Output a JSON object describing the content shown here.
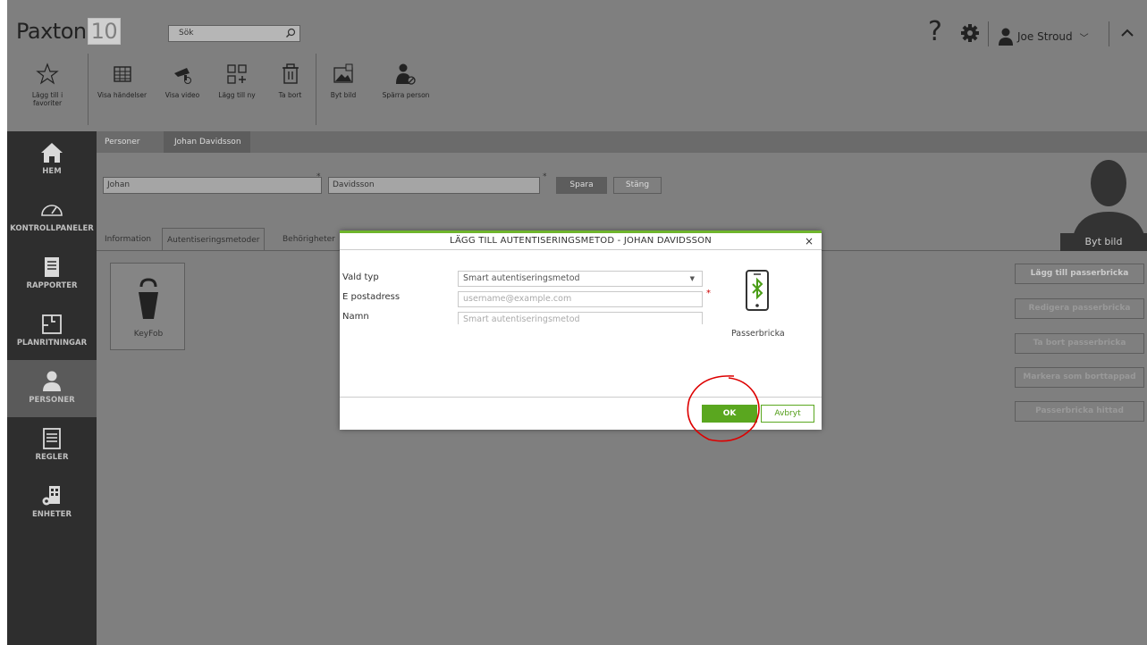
{
  "app": {
    "logo": "Paxton",
    "version": "10"
  },
  "search": {
    "label": "Sök"
  },
  "user": {
    "name": "Joe Stroud"
  },
  "help_label": "?",
  "toolbar": [
    {
      "label": "Lägg till i favoriter",
      "icon": "star-icon"
    },
    {
      "label": "Visa händelser",
      "icon": "events-icon"
    },
    {
      "label": "Visa video",
      "icon": "camera-icon"
    },
    {
      "label": "Lägg till ny",
      "icon": "add-grid-icon"
    },
    {
      "label": "Ta bort",
      "icon": "trash-icon"
    },
    {
      "label": "Byt bild",
      "icon": "image-icon"
    },
    {
      "label": "Spärra person",
      "icon": "block-person-icon"
    }
  ],
  "sidebar": [
    {
      "label": "HEM",
      "icon": "home-icon"
    },
    {
      "label": "KONTROLLPANELER",
      "icon": "dashboard-icon"
    },
    {
      "label": "RAPPORTER",
      "icon": "report-icon"
    },
    {
      "label": "PLANRITNINGAR",
      "icon": "floorplan-icon"
    },
    {
      "label": "PERSONER",
      "icon": "person-icon"
    },
    {
      "label": "REGLER",
      "icon": "rules-icon"
    },
    {
      "label": "ENHETER",
      "icon": "devices-icon"
    }
  ],
  "breadcrumb": {
    "root": "Personer",
    "current": "Johan Davidsson"
  },
  "person": {
    "first_name": "Johan",
    "last_name": "Davidsson",
    "required_mark": "*"
  },
  "buttons": {
    "save": "Spara",
    "close": "Stäng"
  },
  "tabs": [
    "Information",
    "Autentiseringsmetoder",
    "Behörigheter"
  ],
  "keyfob": {
    "label": "KeyFob"
  },
  "avatar": {
    "button": "Byt bild"
  },
  "side_actions": [
    "Lägg till passerbricka",
    "Redigera passerbricka",
    "Ta bort passerbricka",
    "Markera som borttappad",
    "Passerbricka hittad"
  ],
  "modal": {
    "title": "LÄGG TILL AUTENTISERINGSMETOD - JOHAN DAVIDSSON",
    "close": "×",
    "type_label": "Vald typ",
    "type_value": "Smart autentiseringsmetod",
    "email_label": "E postadress",
    "email_placeholder": "username@example.com",
    "email_required": "*",
    "name_label": "Namn",
    "name_placeholder": "Smart autentiseringsmetod",
    "device_label": "Passerbricka",
    "ok": "OK",
    "cancel": "Avbryt"
  },
  "colors": {
    "accent": "#5aa71f",
    "header": "#7f7f7f",
    "sidebar": "#2e2e2e"
  }
}
